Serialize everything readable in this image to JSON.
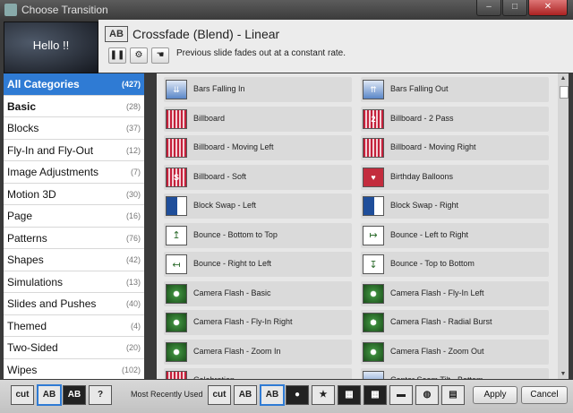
{
  "window": {
    "title": "Choose Transition",
    "minimize": "–",
    "maximize": "□",
    "close": "✕"
  },
  "header": {
    "preview_text": "Hello !!",
    "logo_text": "AB",
    "transition_title": "Crossfade (Blend) - Linear",
    "description": "Previous slide fades out at a constant rate.",
    "controls": [
      {
        "name": "pause",
        "glyph": "❚❚"
      },
      {
        "name": "settings",
        "glyph": "⚙"
      },
      {
        "name": "hand",
        "glyph": "☚"
      }
    ]
  },
  "categories": [
    {
      "label": "All Categories",
      "count": "(427)",
      "selected": true
    },
    {
      "label": "Basic",
      "count": "(28)",
      "bold": true
    },
    {
      "label": "Blocks",
      "count": "(37)"
    },
    {
      "label": "Fly-In and Fly-Out",
      "count": "(12)"
    },
    {
      "label": "Image Adjustments",
      "count": "(7)"
    },
    {
      "label": "Motion 3D",
      "count": "(30)"
    },
    {
      "label": "Page",
      "count": "(16)"
    },
    {
      "label": "Patterns",
      "count": "(76)"
    },
    {
      "label": "Shapes",
      "count": "(42)"
    },
    {
      "label": "Simulations",
      "count": "(13)"
    },
    {
      "label": "Slides and Pushes",
      "count": "(40)"
    },
    {
      "label": "Themed",
      "count": "(4)"
    },
    {
      "label": "Two-Sided",
      "count": "(20)"
    },
    {
      "label": "Wipes",
      "count": "(102)"
    }
  ],
  "transitions": [
    {
      "label": "Bars Falling In",
      "icon": "bars-falling-icon",
      "style": "blue",
      "glyph": "⇊"
    },
    {
      "label": "Bars Falling Out",
      "icon": "bars-falling-icon",
      "style": "blue",
      "glyph": "⇈"
    },
    {
      "label": "Billboard",
      "icon": "billboard-icon",
      "style": "red",
      "glyph": ""
    },
    {
      "label": "Billboard - 2 Pass",
      "icon": "billboard-icon",
      "style": "red",
      "glyph": "2"
    },
    {
      "label": "Billboard - Moving Left",
      "icon": "billboard-icon",
      "style": "red",
      "glyph": ""
    },
    {
      "label": "Billboard - Moving Right",
      "icon": "billboard-icon",
      "style": "red",
      "glyph": ""
    },
    {
      "label": "Billboard - Soft",
      "icon": "billboard-icon",
      "style": "red",
      "glyph": "S"
    },
    {
      "label": "Birthday Balloons",
      "icon": "balloon-icon",
      "style": "balloon",
      "glyph": "♥"
    },
    {
      "label": "Block Swap - Left",
      "icon": "block-swap-icon",
      "style": "dblue",
      "glyph": ""
    },
    {
      "label": "Block Swap - Right",
      "icon": "block-swap-icon",
      "style": "dblue",
      "glyph": ""
    },
    {
      "label": "Bounce - Bottom to Top",
      "icon": "bounce-icon",
      "style": "green",
      "glyph": "↥"
    },
    {
      "label": "Bounce - Left to Right",
      "icon": "bounce-icon",
      "style": "green",
      "glyph": "↦"
    },
    {
      "label": "Bounce - Right to Left",
      "icon": "bounce-icon",
      "style": "green",
      "glyph": "↤"
    },
    {
      "label": "Bounce - Top to Bottom",
      "icon": "bounce-icon",
      "style": "green",
      "glyph": "↧"
    },
    {
      "label": "Camera Flash - Basic",
      "icon": "camera-flash-icon",
      "style": "gflash",
      "glyph": ""
    },
    {
      "label": "Camera Flash - Fly-In Left",
      "icon": "camera-flash-icon",
      "style": "gflash",
      "glyph": "→"
    },
    {
      "label": "Camera Flash - Fly-In Right",
      "icon": "camera-flash-icon",
      "style": "gflash",
      "glyph": "←"
    },
    {
      "label": "Camera Flash - Radial Burst",
      "icon": "camera-flash-icon",
      "style": "gflash",
      "glyph": "✱"
    },
    {
      "label": "Camera Flash - Zoom In",
      "icon": "camera-flash-icon",
      "style": "gflash",
      "glyph": "+"
    },
    {
      "label": "Camera Flash - Zoom Out",
      "icon": "camera-flash-icon",
      "style": "gflash",
      "glyph": "–"
    },
    {
      "label": "Celebration",
      "icon": "celebration-icon",
      "style": "red",
      "glyph": ""
    },
    {
      "label": "Center Seam Tilt - Bottom",
      "icon": "seam-tilt-icon",
      "style": "blue",
      "glyph": ""
    }
  ],
  "bottom": {
    "left_buttons": [
      {
        "label": "cut",
        "icon": "cut-icon"
      },
      {
        "label": "AB",
        "icon": "crossfade-icon",
        "selected": true
      },
      {
        "label": "AB",
        "icon": "crossfade-dim-icon",
        "dark": true
      },
      {
        "label": "?",
        "icon": "random-icon"
      }
    ],
    "mru_label": "Most Recently Used",
    "mru_buttons": [
      {
        "label": "cut",
        "icon": "cut-icon"
      },
      {
        "label": "AB",
        "icon": "crossfade-icon"
      },
      {
        "label": "AB",
        "icon": "crossfade-icon",
        "selected": true
      },
      {
        "label": "●",
        "icon": "circle-icon",
        "dark": true
      },
      {
        "label": "★",
        "icon": "star-icon"
      },
      {
        "label": "▦",
        "icon": "checker-icon",
        "dark": true
      },
      {
        "label": "▦",
        "icon": "checker-icon",
        "dark": true
      },
      {
        "label": "▬",
        "icon": "wipe-icon"
      },
      {
        "label": "◍",
        "icon": "iris-icon"
      },
      {
        "label": "▤",
        "icon": "blinds-icon"
      }
    ],
    "apply_label": "Apply",
    "cancel_label": "Cancel"
  }
}
